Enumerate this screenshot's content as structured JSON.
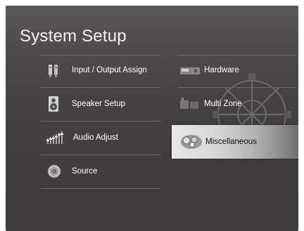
{
  "screen": {
    "title": "System Setup"
  },
  "menu_left": [
    {
      "label": "Input / Output Assign",
      "icon": "input-output-icon"
    },
    {
      "label": "Speaker Setup",
      "icon": "speaker-icon"
    },
    {
      "label": "Audio Adjust",
      "icon": "audio-adjust-icon"
    },
    {
      "label": "Source",
      "icon": "source-disc-icon"
    }
  ],
  "menu_right": [
    {
      "label": "Hardware",
      "icon": "hardware-icon"
    },
    {
      "label": "Multi Zone",
      "icon": "multi-zone-icon"
    },
    {
      "label": "Miscellaneous",
      "icon": "miscellaneous-icon",
      "selected": true
    }
  ],
  "colors": {
    "background": "#464242",
    "text": "#ffffff",
    "selection": "#d6d6d6"
  }
}
